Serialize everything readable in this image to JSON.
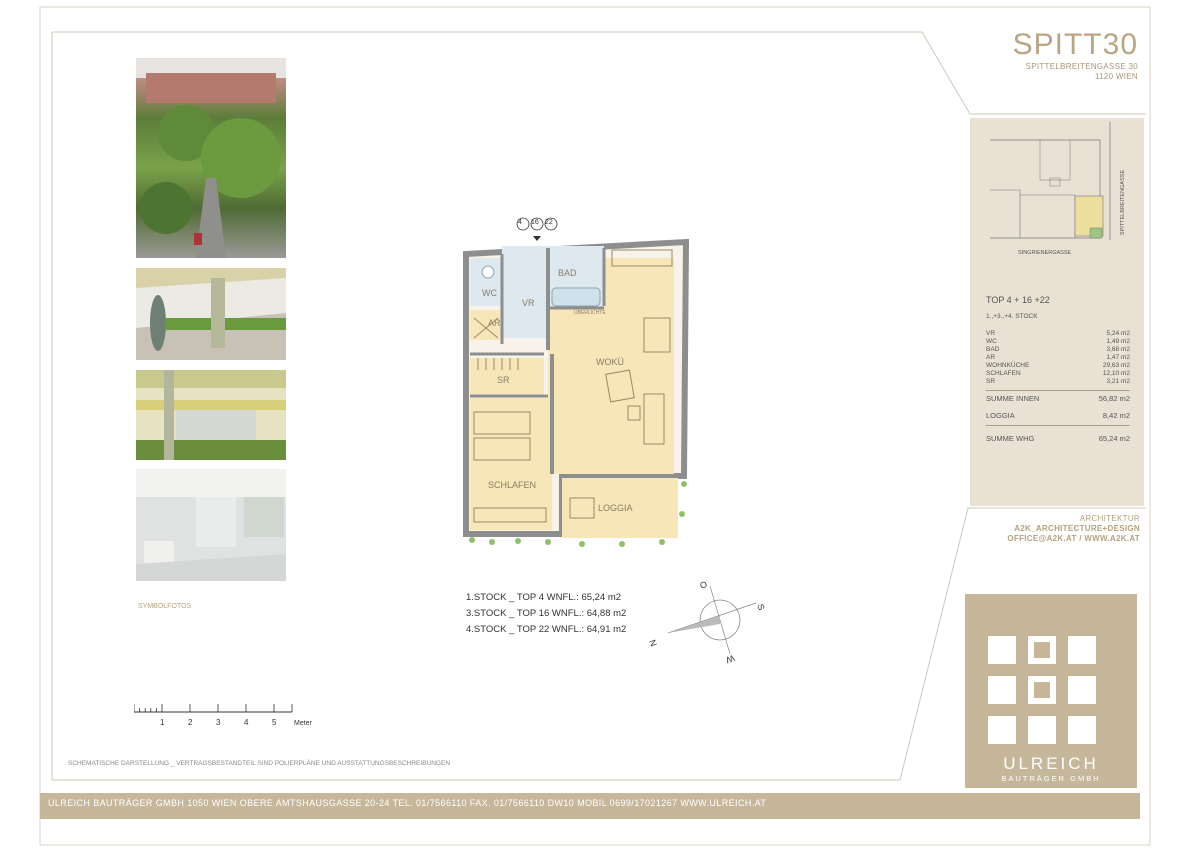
{
  "project": {
    "title": "SPITT30",
    "street": "SPITTELBREITENGASSE 30",
    "city": "1120 WIEN"
  },
  "site_plan": {
    "street_right": "SPITTELBREITENGASSE",
    "street_bottom": "SINGRIENERGASSE"
  },
  "unit": {
    "title": "TOP 4 + 16 +22",
    "floors": "1.,+3.,+4. STOCK",
    "rooms": [
      {
        "name": "VR",
        "area": "5,24 m2"
      },
      {
        "name": "WC",
        "area": "1,49 m2"
      },
      {
        "name": "BAD",
        "area": "3,68 m2"
      },
      {
        "name": "AR",
        "area": "1,47 m2"
      },
      {
        "name": "WOHNKÜCHE",
        "area": "29,63 m2"
      },
      {
        "name": "SCHLAFEN",
        "area": "12,10 m2"
      },
      {
        "name": "SR",
        "area": "3,21 m2"
      }
    ],
    "sum_inside_label": "SUMME INNEN",
    "sum_inside": "56,82 m2",
    "loggia_label": "LOGGIA",
    "loggia": "8,42 m2",
    "sum_total_label": "SUMME WHG",
    "sum_total": "65,24 m2"
  },
  "architect": {
    "label": "ARCHITEKTUR",
    "name": "A2K_ARCHITECTURE+DESIGN",
    "contact": "OFFICE@A2K.AT / WWW.A2K.AT"
  },
  "brand": {
    "name": "ULREICH",
    "sub": "BAUTRÄGER GMBH"
  },
  "floorplan": {
    "unit_markers": [
      "4",
      "16",
      "22"
    ],
    "rooms": {
      "bad": "BAD",
      "wc": "WC",
      "vr": "VR",
      "ar": "AR",
      "sr": "SR",
      "woku": "WOKÜ",
      "schlafen": "SCHLAFEN",
      "loggia": "LOGGIA",
      "ueberlicht": "ÜBERLICHTE"
    },
    "variants": [
      "1.STOCK _ TOP 4   WNFL.: 65,24 m2",
      "3.STOCK _ TOP 16  WNFL.: 64,88 m2",
      "4.STOCK _ TOP 22  WNFL.: 64,91 m2"
    ]
  },
  "compass": {
    "n": "N",
    "o": "O",
    "s": "S",
    "w": "W"
  },
  "scale": {
    "ticks": [
      "1",
      "2",
      "3",
      "4",
      "5"
    ],
    "unit": "Meter"
  },
  "photos_caption": "SYMBOLFOTOS",
  "disclaimer": "SCHEMATISCHE DARSTELLUNG _ VERTRAGSBESTANDTEIL SIND POLIERPLÄNE UND AUSSTATTUNGSBESCHREIBUNGEN",
  "footer": "ULREICH BAUTRÄGER GMBH    1050 WIEN OBERE AMTSHAUSGASSE 20-24    TEL. 01/7566110  FAX. 01/7566110 DW10    MOBIL 0699/17021267    WWW.ULREICH.AT",
  "colors": {
    "accent": "#c6b79b",
    "panel": "#e8e1d4",
    "title": "#b9a582",
    "room_fill": "#f6e6b8",
    "wet_fill": "#dde9ee"
  }
}
